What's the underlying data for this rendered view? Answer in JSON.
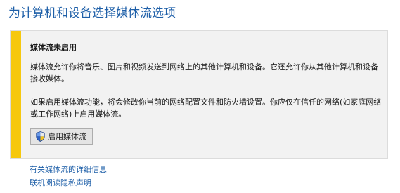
{
  "page": {
    "title": "为计算机和设备选择媒体流选项"
  },
  "notice": {
    "heading": "媒体流未启用",
    "paragraph1": "媒体流允许你将音乐、图片和视频发送到网络上的其他计算机和设备。它还允许你从其他计算机和设备接收媒体。",
    "paragraph2": "如果启用媒体流功能，将会修改你当前的网络配置文件和防火墙设置。你应仅在信任的网络(如家庭网络或工作网络)上启用媒体流。",
    "enable_button": {
      "label": "启用媒体流",
      "icon": "uac-shield-icon"
    }
  },
  "links": {
    "details": "有关媒体流的详细信息",
    "privacy": "联机阅读隐私声明"
  },
  "colors": {
    "accent_link": "#1e5fa8",
    "warning_bar": "#f6c80d",
    "panel_background": "#f2f2f2"
  }
}
